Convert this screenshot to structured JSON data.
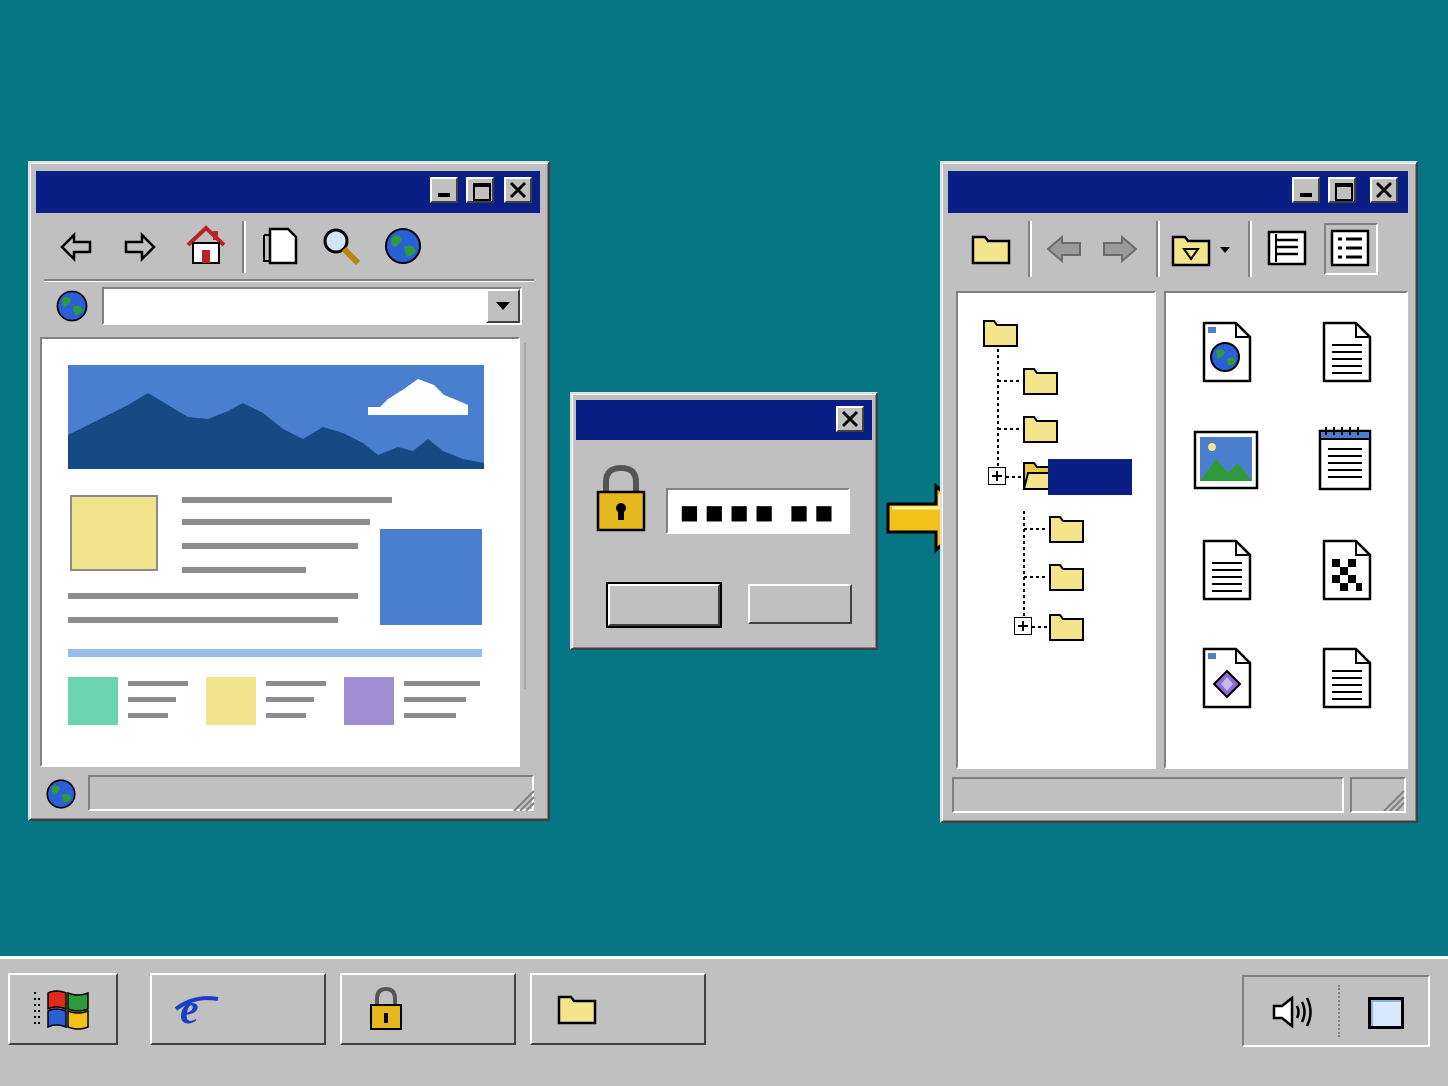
{
  "colors": {
    "desktop": "#067684",
    "titlebar": "#0a1f86",
    "chrome": "#c0c0c0",
    "folder": "#f4e58c",
    "highlight": "#0a1f86",
    "arrow": "#f2c21a",
    "banner_sky": "#4a7fd0",
    "banner_mountain": "#174a84",
    "tile_green": "#6cd3b0",
    "tile_yellow": "#f2e48c",
    "tile_purple": "#a08ed2",
    "tile_blue": "#4a7fd0"
  },
  "browser": {
    "title": "",
    "address": {
      "value": "",
      "placeholder": ""
    },
    "status_text": "",
    "toolbar_icons": [
      "back-arrow-icon",
      "forward-arrow-icon",
      "home-icon",
      "page-icon",
      "search-magnifier-icon",
      "globe-icon"
    ]
  },
  "login_dialog": {
    "title": "",
    "password_mask": "■■■■ ■■",
    "ok_label": "",
    "cancel_label": ""
  },
  "explorer": {
    "title": "",
    "toolbar_icons": [
      "folder-icon",
      "back-arrow-icon",
      "forward-arrow-icon",
      "folder-dropdown-icon",
      "details-view-icon",
      "list-view-icon"
    ],
    "tree_items": [
      "root",
      "child",
      "child",
      "selected",
      "nested",
      "nested",
      "nested-collapsed"
    ],
    "selected_label": "",
    "files": [
      "web-document-icon",
      "text-document-icon",
      "image-file-icon",
      "notepad-icon",
      "text-document-icon",
      "qr-code-file-icon",
      "diamond-file-icon",
      "text-document-icon"
    ],
    "status_text": ""
  },
  "taskbar": {
    "start_label": "",
    "buttons": [
      {
        "icon": "internet-explorer-icon",
        "label": ""
      },
      {
        "icon": "lock-icon",
        "label": ""
      },
      {
        "icon": "folder-icon",
        "label": ""
      }
    ],
    "tray_icons": [
      "speaker-icon",
      "desktop-square-icon"
    ]
  }
}
